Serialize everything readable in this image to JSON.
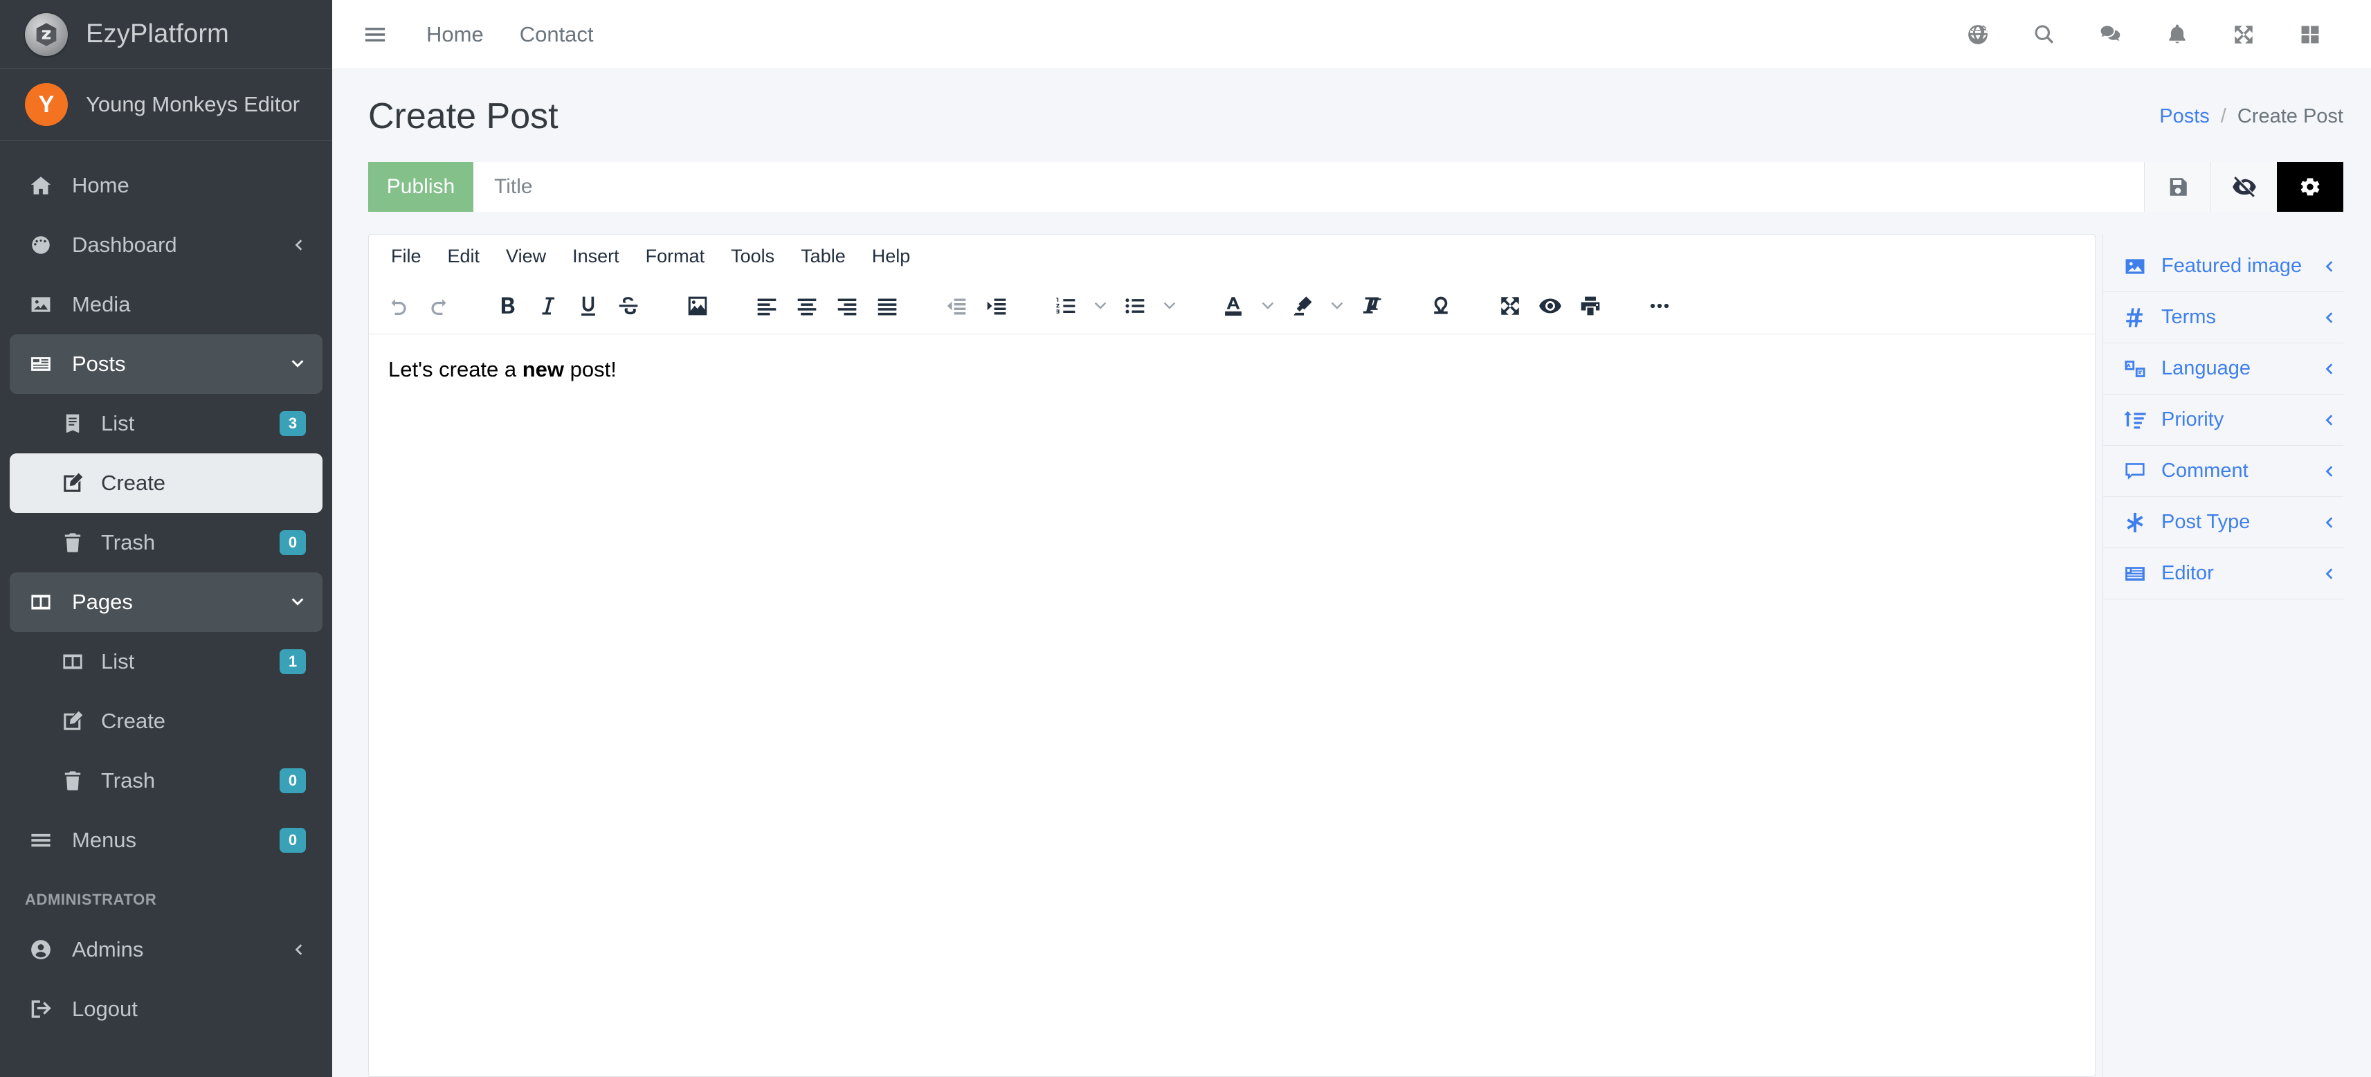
{
  "brand": {
    "title": "EzyPlatform",
    "logo_icon": "ezyplatform-logo-icon"
  },
  "user": {
    "name": "Young Monkeys Editor",
    "initial": "Y",
    "avatar_color": "#f47321"
  },
  "sidebar": {
    "items": [
      {
        "label": "Home",
        "icon": "home-icon",
        "badge": null,
        "chevron": null,
        "state": "normal",
        "level": 0
      },
      {
        "label": "Dashboard",
        "icon": "dashboard-gauge-icon",
        "badge": null,
        "chevron": "left",
        "state": "normal",
        "level": 0
      },
      {
        "label": "Media",
        "icon": "media-image-icon",
        "badge": null,
        "chevron": null,
        "state": "normal",
        "level": 0
      },
      {
        "label": "Posts",
        "icon": "posts-icon",
        "badge": null,
        "chevron": "down",
        "state": "expanded",
        "level": 0
      },
      {
        "label": "List",
        "icon": "list-book-icon",
        "badge": "3",
        "chevron": null,
        "state": "normal",
        "level": 1
      },
      {
        "label": "Create",
        "icon": "create-pencil-icon",
        "badge": null,
        "chevron": null,
        "state": "active",
        "level": 1
      },
      {
        "label": "Trash",
        "icon": "trash-icon",
        "badge": "0",
        "chevron": null,
        "state": "normal",
        "level": 1
      },
      {
        "label": "Pages",
        "icon": "pages-icon",
        "badge": null,
        "chevron": "down",
        "state": "expanded",
        "level": 0
      },
      {
        "label": "List",
        "icon": "pages-icon",
        "badge": "1",
        "chevron": null,
        "state": "normal",
        "level": 1
      },
      {
        "label": "Create",
        "icon": "create-pencil-icon",
        "badge": null,
        "chevron": null,
        "state": "normal",
        "level": 1
      },
      {
        "label": "Trash",
        "icon": "trash-icon",
        "badge": "0",
        "chevron": null,
        "state": "normal",
        "level": 1
      },
      {
        "label": "Menus",
        "icon": "menus-bars-icon",
        "badge": "0",
        "chevron": null,
        "state": "normal",
        "level": 0
      }
    ],
    "section_header": "ADMINISTRATOR",
    "admin_items": [
      {
        "label": "Admins",
        "icon": "user-circle-icon",
        "badge": null,
        "chevron": "left",
        "state": "normal",
        "level": 0
      },
      {
        "label": "Logout",
        "icon": "logout-icon",
        "badge": null,
        "chevron": null,
        "state": "normal",
        "level": 0
      }
    ],
    "badge_color": "#39a2b8",
    "background": "#343a40"
  },
  "topbar": {
    "menu_icon": "hamburger-icon",
    "links": [
      {
        "label": "Home"
      },
      {
        "label": "Contact"
      }
    ],
    "icons": [
      {
        "name": "globe-icon"
      },
      {
        "name": "search-icon"
      },
      {
        "name": "comments-icon"
      },
      {
        "name": "bell-icon"
      },
      {
        "name": "expand-arrows-icon"
      },
      {
        "name": "grid-apps-icon"
      }
    ]
  },
  "page": {
    "title": "Create Post",
    "breadcrumb": {
      "parent": "Posts",
      "separator": "/",
      "current": "Create Post"
    }
  },
  "toolbar": {
    "publish_label": "Publish",
    "title_placeholder": "Title",
    "title_value": "",
    "actions": [
      {
        "name": "save-icon",
        "active": false
      },
      {
        "name": "eye-slash-icon",
        "active": false
      },
      {
        "name": "gear-icon",
        "active": true
      }
    ],
    "publish_color": "#84c08a"
  },
  "editor": {
    "menubar": [
      "File",
      "Edit",
      "View",
      "Insert",
      "Format",
      "Tools",
      "Table",
      "Help"
    ],
    "toolbar_items": [
      {
        "name": "undo-icon",
        "muted": true
      },
      {
        "name": "redo-icon",
        "muted": true
      },
      {
        "name": "bold-icon",
        "muted": false
      },
      {
        "name": "italic-icon",
        "muted": false
      },
      {
        "name": "underline-icon",
        "muted": false
      },
      {
        "name": "strikethrough-icon",
        "muted": false
      },
      {
        "name": "insert-image-icon",
        "muted": false
      },
      {
        "name": "align-left-icon",
        "muted": false
      },
      {
        "name": "align-center-icon",
        "muted": false
      },
      {
        "name": "align-right-icon",
        "muted": false
      },
      {
        "name": "align-justify-icon",
        "muted": false
      },
      {
        "name": "outdent-icon",
        "muted": true
      },
      {
        "name": "indent-icon",
        "muted": false
      },
      {
        "name": "numbered-list-icon",
        "muted": false
      },
      {
        "name": "bullet-list-icon",
        "muted": false
      },
      {
        "name": "text-color-icon",
        "muted": false
      },
      {
        "name": "highlight-color-icon",
        "muted": false
      },
      {
        "name": "clear-formatting-icon",
        "muted": false
      },
      {
        "name": "special-character-icon",
        "muted": false
      },
      {
        "name": "fullscreen-icon",
        "muted": false
      },
      {
        "name": "preview-eye-icon",
        "muted": false
      },
      {
        "name": "print-icon",
        "muted": false
      },
      {
        "name": "more-options-icon",
        "muted": false
      }
    ],
    "content_before": "Let's create a ",
    "content_bold": "new",
    "content_after": " post!"
  },
  "right_panel": {
    "items": [
      {
        "label": "Featured image",
        "icon": "featured-image-icon"
      },
      {
        "label": "Terms",
        "icon": "hash-terms-icon"
      },
      {
        "label": "Language",
        "icon": "language-translate-icon"
      },
      {
        "label": "Priority",
        "icon": "priority-sort-icon"
      },
      {
        "label": "Comment",
        "icon": "comment-bubble-icon"
      },
      {
        "label": "Post Type",
        "icon": "post-type-asterisk-icon"
      },
      {
        "label": "Editor",
        "icon": "editor-icon"
      }
    ],
    "accent_color": "#3f7fec"
  }
}
